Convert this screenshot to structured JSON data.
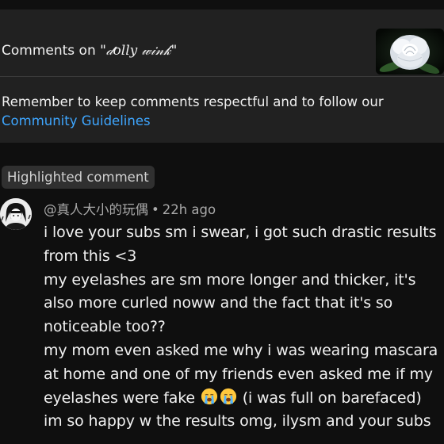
{
  "header": {
    "title_prefix": "Comments on \"",
    "video_name": "𝒹olly 𝓌𝒾𝓃𝓀",
    "title_suffix": "\"",
    "thumbnail_icon": "white-rose-thumbnail"
  },
  "notice": {
    "text": "Remember to keep comments respectful and to follow our",
    "link_label": "Community Guidelines"
  },
  "highlighted": {
    "badge_label": "Highlighted comment",
    "author": "@真人大小的玩偶",
    "separator": "•",
    "time": "22h ago",
    "avatar_icon": "user-avatar",
    "lines": [
      "i love your subs sm i swear, i got such drastic results",
      "from this <3",
      "my eyelashes are sm more longer and thicker, it's",
      "also more curled noww and the fact that it's so",
      "noticeable too??",
      "my mom even asked me why i was wearing mascara",
      "at home and one of my friends even asked me if my"
    ],
    "line8_before": "eyelashes were fake",
    "line8_emoji": "loudly-crying-face-emoji",
    "line8_after": "(i was full on barefaced)",
    "last_line": "im so happy w the results omg, ilysm and your subs"
  },
  "colors": {
    "background": "#0f0f0f",
    "panel": "#212121",
    "link": "#3ea6ff",
    "badge_bg": "#303030",
    "meta_text": "#aaaaaa"
  }
}
